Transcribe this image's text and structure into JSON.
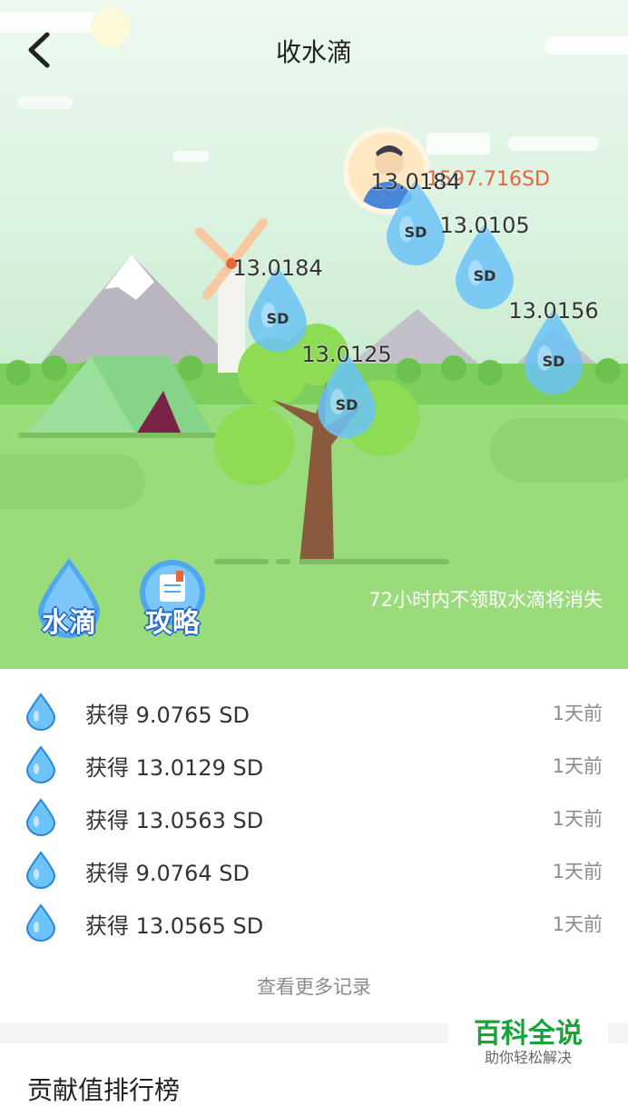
{
  "header": {
    "title": "收水滴"
  },
  "user": {
    "balance": "1597.716SD"
  },
  "drops": [
    {
      "value": "13.0184",
      "unit": "SD"
    },
    {
      "value": "13.0105",
      "unit": "SD"
    },
    {
      "value": "13.0184",
      "unit": "SD"
    },
    {
      "value": "13.0156",
      "unit": "SD"
    },
    {
      "value": "13.0125",
      "unit": "SD"
    }
  ],
  "actions": {
    "water_label": "水滴",
    "guide_label": "攻略"
  },
  "hint": "72小时内不领取水滴将消失",
  "records": [
    {
      "text": "获得  9.0765 SD",
      "time": "1天前"
    },
    {
      "text": "获得  13.0129 SD",
      "time": "1天前"
    },
    {
      "text": "获得  13.0563 SD",
      "time": "1天前"
    },
    {
      "text": "获得  9.0764 SD",
      "time": "1天前"
    },
    {
      "text": "获得  13.0565 SD",
      "time": "1天前"
    }
  ],
  "more_label": "查看更多记录",
  "ranking_title": "贡献值排行榜",
  "watermark": {
    "brand": "百科全说",
    "slogan": "助你轻松解决"
  },
  "colors": {
    "balance": "#e8643a",
    "drop": "#4fb4f5",
    "brand": "#1aa33a"
  },
  "icons": {
    "back": "chevron-left-icon",
    "drop": "water-drop-icon",
    "guide": "book-icon"
  }
}
